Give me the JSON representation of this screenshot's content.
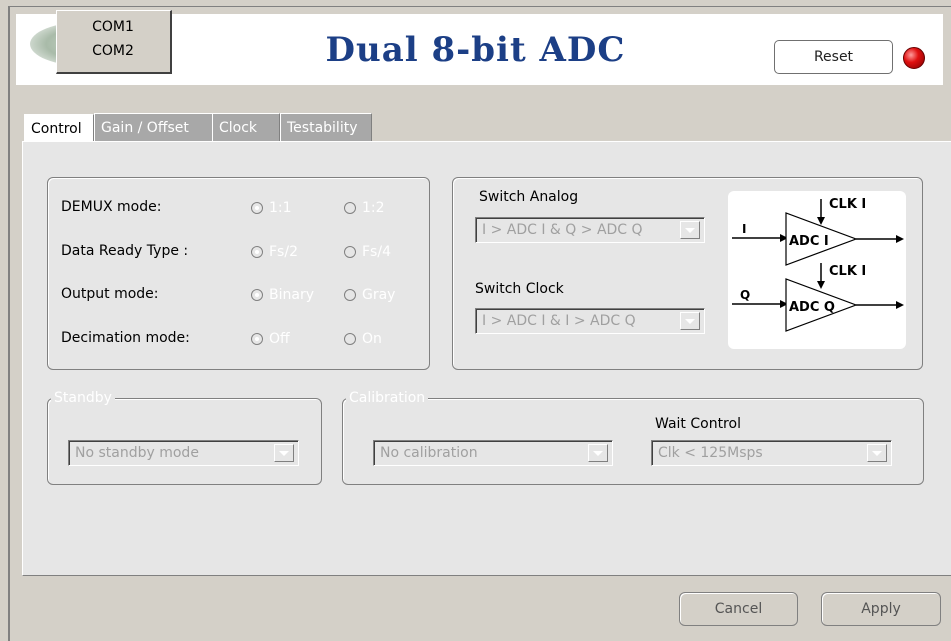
{
  "header": {
    "title": "Dual 8-bit ADC",
    "reset_label": "Reset",
    "led_color": "#e01010",
    "title_color": "#1c3f86"
  },
  "com_menu": {
    "items": [
      "COM1",
      "COM2"
    ]
  },
  "tabs": [
    {
      "label": "Control",
      "active": true
    },
    {
      "label": "Gain / Offset",
      "active": false
    },
    {
      "label": "Clock",
      "active": false
    },
    {
      "label": "Testability",
      "active": false
    }
  ],
  "modes": [
    {
      "label": "DEMUX mode:",
      "options": [
        "1:1",
        "1:2"
      ],
      "selected": 0
    },
    {
      "label": "Data Ready Type :",
      "options": [
        "Fs/2",
        "Fs/4"
      ],
      "selected": 0
    },
    {
      "label": "Output mode:",
      "options": [
        "Binary",
        "Gray"
      ],
      "selected": 0
    },
    {
      "label": "Decimation mode:",
      "options": [
        "Off",
        "On"
      ],
      "selected": 0
    }
  ],
  "switch_analog": {
    "label": "Switch Analog",
    "value": "I > ADC I  &  Q > ADC Q"
  },
  "switch_clock": {
    "label": "Switch Clock",
    "value": "I > ADC I  &  I > ADC Q"
  },
  "diagram": {
    "clk_top": "CLK I",
    "clk_bottom": "CLK I",
    "in_top": "I",
    "in_bottom": "Q",
    "adc_top": "ADC I",
    "adc_bottom": "ADC Q"
  },
  "standby": {
    "legend": "Standby",
    "value": "No standby mode"
  },
  "calibration": {
    "legend": "Calibration",
    "value": "No calibration"
  },
  "wait_control": {
    "label": "Wait Control",
    "value": "Clk < 125Msps"
  },
  "footer": {
    "cancel_label": "Cancel",
    "apply_label": "Apply"
  }
}
